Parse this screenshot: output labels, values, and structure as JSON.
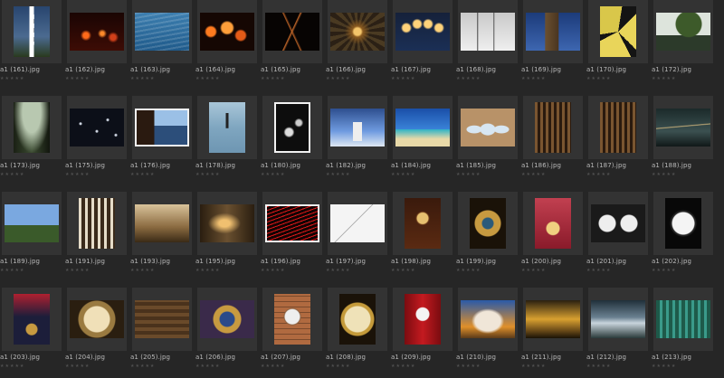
{
  "rating_glyph": "★★★★★",
  "rows": [
    [
      {
        "name": "a1 (161).jpg",
        "art": "lighthouse-stripes",
        "o": "p"
      },
      {
        "name": "a1 (162).jpg",
        "art": "night-lights-dark",
        "o": "l"
      },
      {
        "name": "a1 (163).jpg",
        "art": "blue-water",
        "o": "l"
      },
      {
        "name": "a1 (164).jpg",
        "art": "bokeh-orange",
        "o": "l"
      },
      {
        "name": "a1 (165).jpg",
        "art": "dark-bridge",
        "o": "l"
      },
      {
        "name": "a1 (166).jpg",
        "art": "tunnel-lights",
        "o": "l"
      },
      {
        "name": "a1 (167).jpg",
        "art": "light-bulbs",
        "o": "l"
      },
      {
        "name": "a1 (168).jpg",
        "art": "snow-trees",
        "o": "l"
      },
      {
        "name": "a1 (169).jpg",
        "art": "tower-blue",
        "o": "l"
      },
      {
        "name": "a1 (170).jpg",
        "art": "butterfly",
        "o": "p"
      },
      {
        "name": "a1 (172).jpg",
        "art": "tree-rock",
        "o": "l"
      }
    ],
    [
      {
        "name": "a1 (173).jpg",
        "art": "dark-trees",
        "o": "p"
      },
      {
        "name": "a1 (175).jpg",
        "art": "water-drops",
        "o": "l"
      },
      {
        "name": "a1 (176).jpg",
        "art": "pier-blue",
        "o": "l",
        "frame": true
      },
      {
        "name": "a1 (178).jpg",
        "art": "calm-sea",
        "o": "p"
      },
      {
        "name": "a1 (180).jpg",
        "art": "lotus-dark",
        "o": "p",
        "frame": true
      },
      {
        "name": "a1 (182).jpg",
        "art": "lighthouse-sky",
        "o": "l"
      },
      {
        "name": "a1 (184).jpg",
        "art": "palm-beach",
        "o": "l"
      },
      {
        "name": "a1 (185).jpg",
        "art": "arches",
        "o": "l"
      },
      {
        "name": "a1 (186).jpg",
        "art": "organ-pipes",
        "o": "p"
      },
      {
        "name": "a1 (187).jpg",
        "art": "organ-pipes",
        "o": "p"
      },
      {
        "name": "a1 (188).jpg",
        "art": "dark-bridge-river",
        "o": "l"
      }
    ],
    [
      {
        "name": "a1 (189).jpg",
        "art": "castle",
        "o": "l"
      },
      {
        "name": "a1 (191).jpg",
        "art": "cathedral-interior",
        "o": "p"
      },
      {
        "name": "a1 (193).jpg",
        "art": "sepia-building",
        "o": "l"
      },
      {
        "name": "a1 (195).jpg",
        "art": "sepia-street",
        "o": "l"
      },
      {
        "name": "a1 (196).jpg",
        "art": "red-light-trails",
        "o": "l",
        "frame": true
      },
      {
        "name": "a1 (197).jpg",
        "art": "white-sketch",
        "o": "l"
      },
      {
        "name": "a1 (198).jpg",
        "art": "grandfather-clock",
        "o": "p"
      },
      {
        "name": "a1 (199).jpg",
        "art": "astronomical-clock",
        "o": "p"
      },
      {
        "name": "a1 (200).jpg",
        "art": "red-clock-tower",
        "o": "p"
      },
      {
        "name": "a1 (201).jpg",
        "art": "twin-clocks",
        "o": "l"
      },
      {
        "name": "a1 (202).jpg",
        "art": "clock-face-dark",
        "o": "p"
      }
    ],
    [
      {
        "name": "a1 (203).jpg",
        "art": "small-clock-red",
        "o": "p"
      },
      {
        "name": "a1 (204).jpg",
        "art": "ornate-clock-gold",
        "o": "l"
      },
      {
        "name": "a1 (205).jpg",
        "art": "wood-wall",
        "o": "l"
      },
      {
        "name": "a1 (206).jpg",
        "art": "astronomical-clock-blue",
        "o": "l"
      },
      {
        "name": "a1 (207).jpg",
        "art": "brick-clock",
        "o": "p"
      },
      {
        "name": "a1 (208).jpg",
        "art": "gold-clock",
        "o": "p"
      },
      {
        "name": "a1 (209).jpg",
        "art": "clock-red-wall",
        "o": "p"
      },
      {
        "name": "a1 (210).jpg",
        "art": "clouds-orange",
        "o": "l"
      },
      {
        "name": "a1 (211).jpg",
        "art": "golden-sky",
        "o": "l"
      },
      {
        "name": "a1 (212).jpg",
        "art": "storm-sky",
        "o": "l"
      },
      {
        "name": "a1 (213).jpg",
        "art": "forest-teal",
        "o": "l"
      }
    ]
  ]
}
